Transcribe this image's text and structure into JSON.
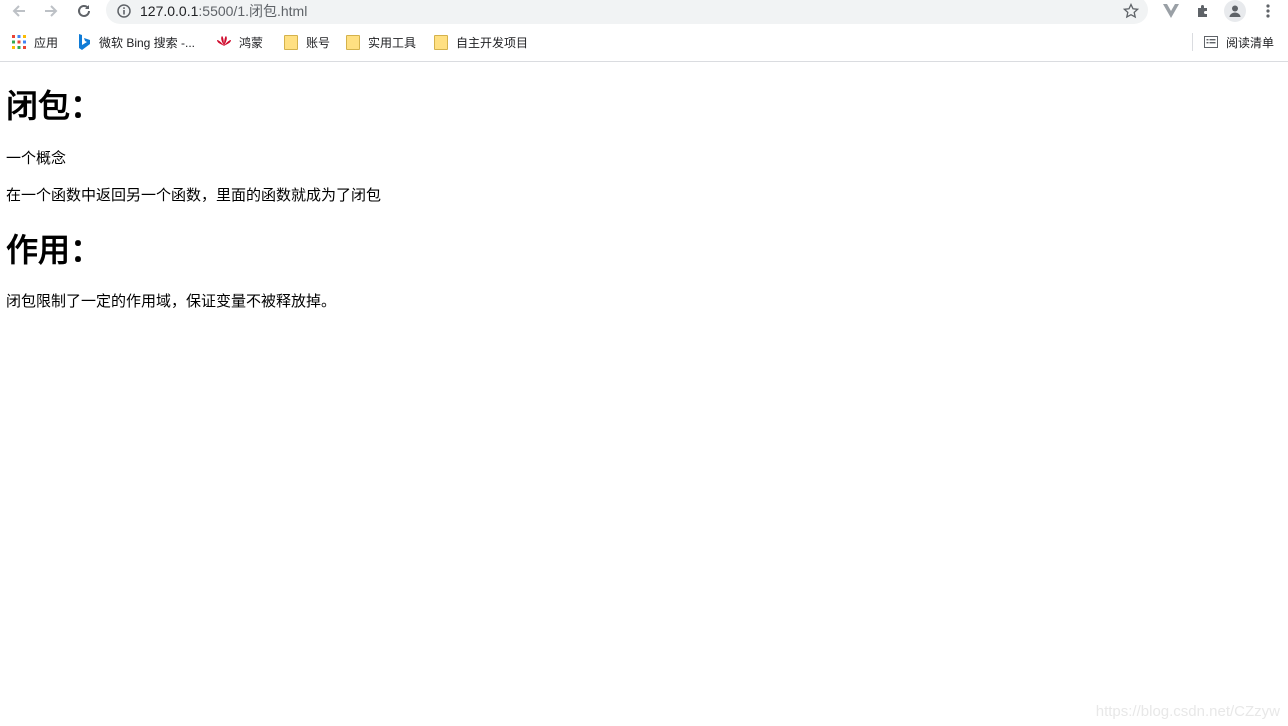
{
  "browser": {
    "url_host": "127.0.0.1",
    "url_path": ":5500/1.闭包.html",
    "bookmarks": [
      {
        "label": "应用",
        "icon": "apps-grid-icon"
      },
      {
        "label": "微软 Bing 搜索 -...",
        "icon": "bing-icon"
      },
      {
        "label": "鸿蒙",
        "icon": "huawei-icon"
      },
      {
        "label": "账号",
        "icon": "folder-icon"
      },
      {
        "label": "实用工具",
        "icon": "folder-icon"
      },
      {
        "label": "自主开发项目",
        "icon": "folder-icon"
      }
    ],
    "reading_list": "阅读清单"
  },
  "page": {
    "heading1": "闭包：",
    "para1": "一个概念",
    "para2": "在一个函数中返回另一个函数，里面的函数就成为了闭包",
    "heading2": "作用：",
    "para3": "闭包限制了一定的作用域，保证变量不被释放掉。"
  },
  "watermark": "https://blog.csdn.net/CZzyw"
}
